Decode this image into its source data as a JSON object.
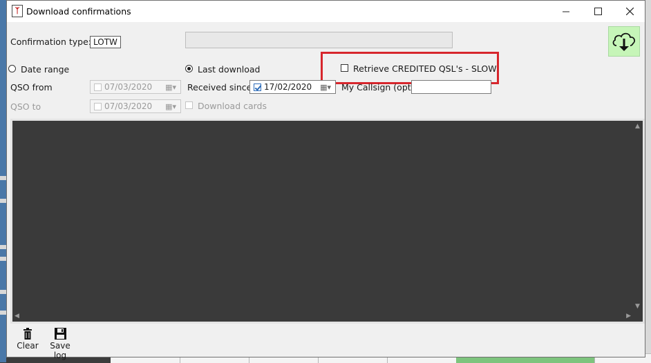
{
  "window": {
    "title": "Download confirmations",
    "controls": [
      "minimize",
      "maximize",
      "close"
    ]
  },
  "form": {
    "confirmation_type_label": "Confirmation type:",
    "confirmation_type_value": "LOTW",
    "date_range_label": "Date range",
    "last_download_label": "Last download",
    "date_range_selected": false,
    "last_download_selected": true,
    "qso_from_label": "QSO from",
    "qso_from_value": "07/03/2020",
    "qso_to_label": "QSO to",
    "qso_to_value": "07/03/2020",
    "received_since_label": "Received since",
    "received_since_value": "17/02/2020",
    "received_since_checked": true,
    "download_cards_label": "Download cards",
    "retrieve_credited_label": "Retrieve CREDITED QSL's - SLOW",
    "retrieve_credited_checked": false,
    "my_callsign_label": "My Callsign (opt)",
    "my_callsign_value": ""
  },
  "toolbar": {
    "clear_label": "Clear",
    "save_log_label": "Save log"
  },
  "icons": {
    "download": "cloud-download-icon",
    "clear": "trash-icon",
    "save_log": "floppy-disk-icon",
    "calendar": "calendar-icon"
  },
  "colors": {
    "download_button_bg": "#c6f5b8",
    "highlight_border": "#d7262c",
    "log_bg": "#3a3a3a"
  }
}
